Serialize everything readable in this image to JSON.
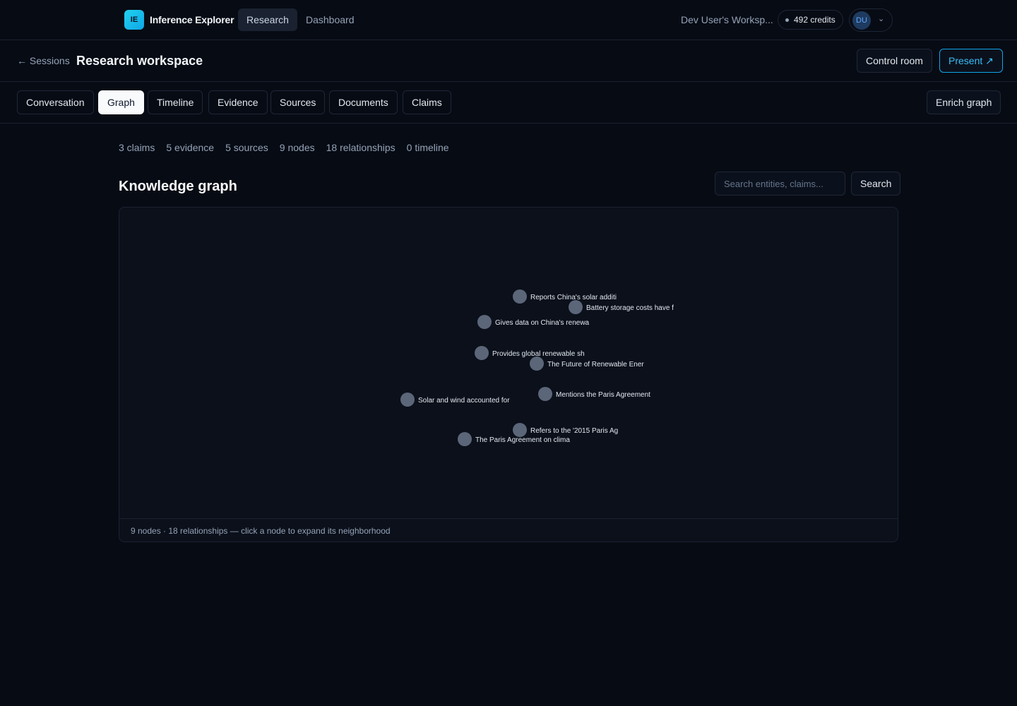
{
  "nav": {
    "logo_text": "IE",
    "brand": "Inference Explorer",
    "links": [
      "Research",
      "Dashboard"
    ],
    "workspace": "Dev User's Worksp...",
    "credits": "492 credits",
    "user_initials": "DU",
    "chevron": "⌄"
  },
  "header": {
    "back": "← Sessions",
    "title": "Research workspace",
    "control_room": "Control room",
    "present": "Present ↗"
  },
  "tabs": [
    "Conversation",
    "Graph",
    "Timeline",
    "Evidence",
    "Sources",
    "Documents",
    "Claims"
  ],
  "active_tab": "Graph",
  "enrich": "Enrich graph",
  "stats": [
    "3 claims",
    "5 evidence",
    "5 sources",
    "9 nodes",
    "18 relationships",
    "0 timeline"
  ],
  "graph": {
    "title": "Knowledge graph",
    "search_placeholder": "Search entities, claims...",
    "search_button": "Search",
    "nodes": [
      {
        "label": "Reports China's solar additi"
      },
      {
        "label": "Battery storage costs have f"
      },
      {
        "label": "Gives data on China's renewa"
      },
      {
        "label": "Provides global renewable sh"
      },
      {
        "label": "The Future of Renewable Ener"
      },
      {
        "label": "Mentions the Paris Agreement"
      },
      {
        "label": "Solar and wind accounted for"
      },
      {
        "label": "Refers to the '2015 Paris Ag"
      },
      {
        "label": "The Paris Agreement on clima"
      }
    ],
    "footer": "9 nodes · 18 relationships — click a node to expand its neighborhood"
  },
  "colors": {
    "background": "#070b14",
    "accent": "#0ea5e9",
    "node": "#5b6679"
  }
}
